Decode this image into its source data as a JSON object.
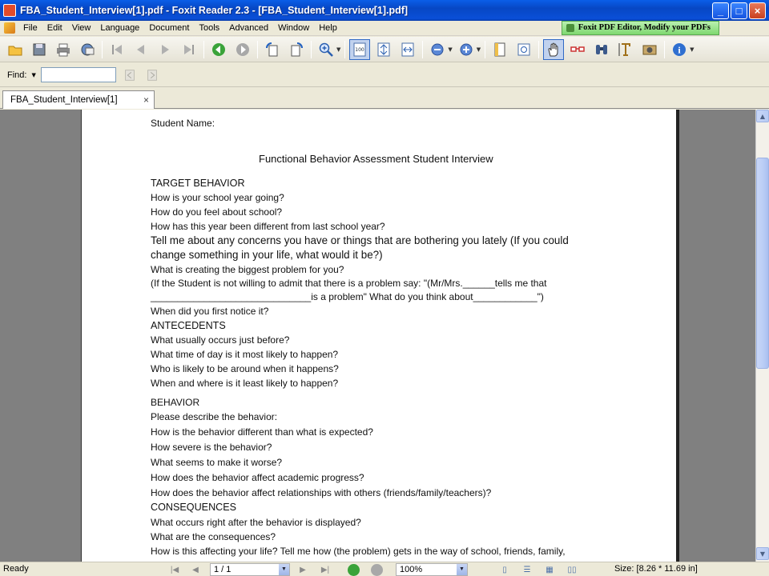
{
  "window": {
    "title": "FBA_Student_Interview[1].pdf - Foxit Reader 2.3 - [FBA_Student_Interview[1].pdf]",
    "minimize": "_",
    "maximize": "□",
    "close": "×"
  },
  "menu": {
    "items": [
      "File",
      "Edit",
      "View",
      "Language",
      "Document",
      "Tools",
      "Advanced",
      "Window",
      "Help"
    ],
    "promo": "Foxit PDF Editor, Modify your PDFs"
  },
  "toolbar": {
    "icons": [
      "open-icon",
      "save-icon",
      "print-icon",
      "email-icon",
      "first-page-icon",
      "previous-page-icon",
      "next-page-icon",
      "last-page-icon",
      "go-back-icon",
      "go-forward-icon",
      "rotate-left-icon",
      "rotate-right-icon",
      "zoom-in-icon",
      "actual-size-icon",
      "fit-page-icon",
      "fit-width-icon",
      "zoom-out-icon",
      "zoom-in-plus-icon",
      "bookmarks-icon",
      "thumbnails-icon",
      "hand-tool-icon",
      "glasses-icon",
      "find-icon",
      "text-select-icon",
      "snapshot-icon",
      "info-icon"
    ]
  },
  "findbar": {
    "label": "Find:",
    "value": ""
  },
  "tabs": [
    {
      "label": "FBA_Student_Interview[1]",
      "close": "×"
    }
  ],
  "document": {
    "lines": [
      "Student Name:",
      "Functional Behavior Assessment Student Interview",
      "TARGET BEHAVIOR",
      "How is your school  year going?",
      "How do you feel about school?",
      "How has this year been different from last school year?",
      "Tell me about any concerns you have or things that are bothering you lately (If you could",
      "change something in your life, what would it be?)",
      "What is creating the biggest problem for you?",
      "(If the Student is not willing to admit that there is a problem say:  \"(Mr/Mrs.______tells me that",
      "______________________________is a problem\"  What do you think about____________\")",
      "When did you first notice it?",
      "ANTECEDENTS",
      "What usually occurs just before?",
      "What time of day is it most likely to happen?",
      "Who is likely to be around when it happens?",
      "When and where is it least likely to happen?",
      "BEHAVIOR",
      "Please describe the behavior:",
      "How is the behavior different than what is expected?",
      "How severe is the behavior?",
      "What seems to make it worse?",
      "How does the behavior affect academic progress?",
      "How does the behavior affect relationships with others (friends/family/teachers)?",
      "CONSEQUENCES",
      "What occurs right after the behavior is displayed?",
      "What are the consequences?",
      "How is this affecting your life?  Tell me how (the problem) gets in the way of school, friends, family,"
    ]
  },
  "status": {
    "ready": "Ready",
    "page": "1 / 1",
    "zoom": "100%",
    "size": "Size: [8.26 * 11.69 in]"
  }
}
